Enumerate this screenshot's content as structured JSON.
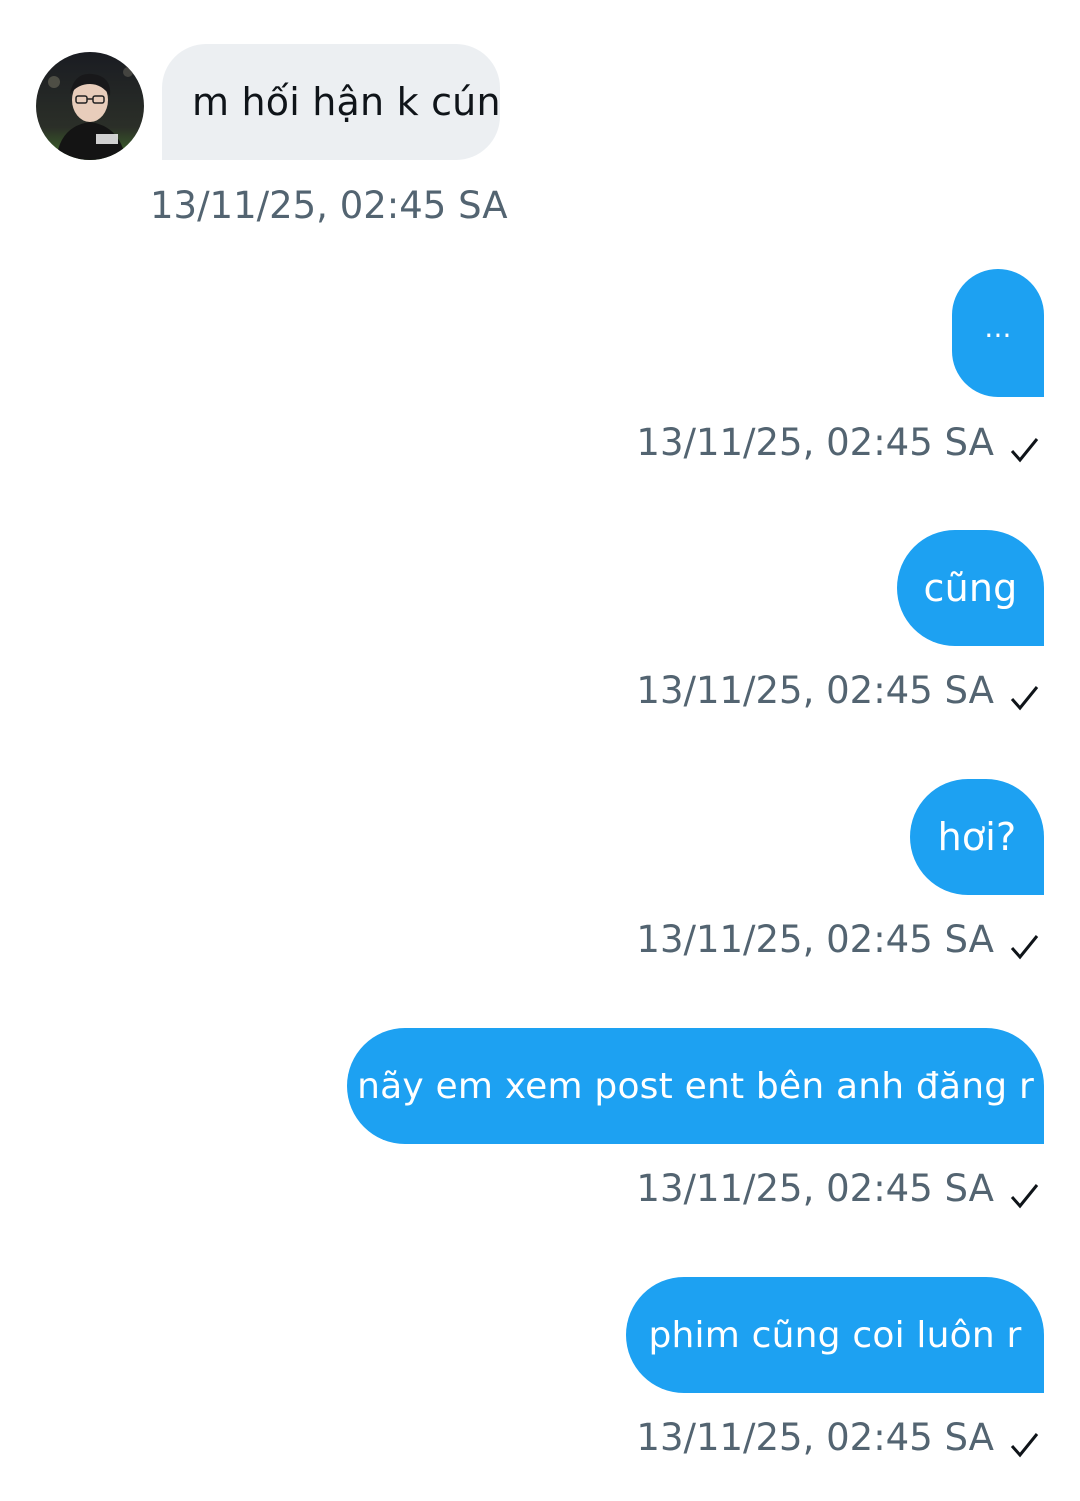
{
  "incoming": {
    "text": "m hối hận k cún",
    "timestamp": "13/11/25, 02:45 SA"
  },
  "outgoing": [
    {
      "text": "...",
      "timestamp": "13/11/25, 02:45 SA"
    },
    {
      "text": "cũng",
      "timestamp": "13/11/25, 02:45 SA"
    },
    {
      "text": "hơi?",
      "timestamp": "13/11/25, 02:45 SA"
    },
    {
      "text": "nãy em xem post ent bên anh đăng r",
      "timestamp": "13/11/25, 02:45 SA"
    },
    {
      "text": "phim cũng coi luôn r",
      "timestamp": "13/11/25, 02:45 SA"
    }
  ],
  "status_icon": "check-icon",
  "colors": {
    "incoming_bubble": "#eceff2",
    "outgoing_bubble": "#1da1f2",
    "timestamp_text": "#536471"
  }
}
